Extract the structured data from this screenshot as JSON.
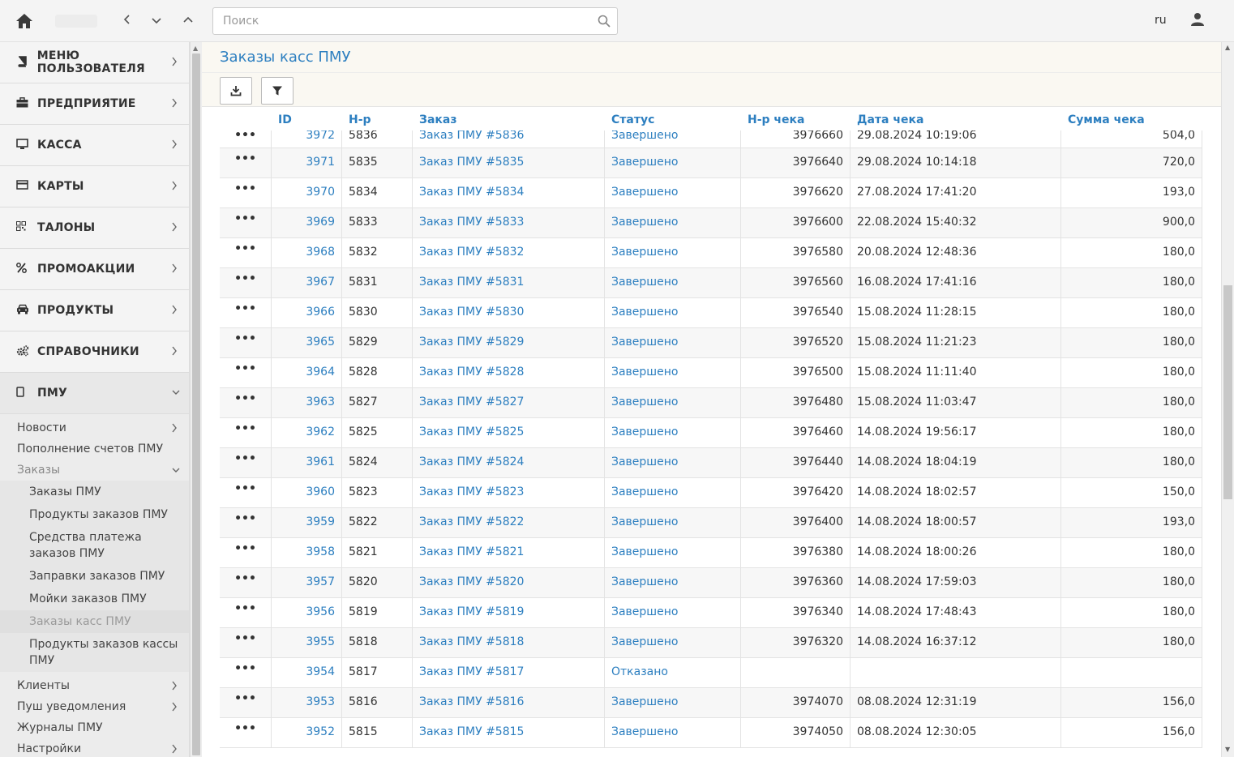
{
  "search": {
    "placeholder": "Поиск"
  },
  "lang": "ru",
  "menu": [
    {
      "label": "МЕНЮ ПОЛЬЗОВАТЕЛЯ",
      "icon": "book-icon"
    },
    {
      "label": "ПРЕДПРИЯТИЕ",
      "icon": "briefcase-icon"
    },
    {
      "label": "КАССА",
      "icon": "monitor-icon"
    },
    {
      "label": "КАРТЫ",
      "icon": "credit-card-icon"
    },
    {
      "label": "ТАЛОНЫ",
      "icon": "qrcode-icon"
    },
    {
      "label": "ПРОМОАКЦИИ",
      "icon": "percent-icon"
    },
    {
      "label": "ПРОДУКТЫ",
      "icon": "car-icon"
    },
    {
      "label": "СПРАВОЧНИКИ",
      "icon": "cogs-icon"
    },
    {
      "label": "ПМУ",
      "icon": "mobile-icon"
    }
  ],
  "pmu_sub": {
    "news": "Новости",
    "topup": "Пополнение счетов ПМУ",
    "orders": "Заказы",
    "orders_sub": [
      "Заказы ПМУ",
      "Продукты заказов ПМУ",
      "Средства платежа заказов ПМУ",
      "Заправки заказов ПМУ",
      "Мойки заказов ПМУ",
      "Заказы касс ПМУ",
      "Продукты заказов кассы ПМУ"
    ],
    "clients": "Клиенты",
    "push": "Пуш уведомления",
    "journals": "Журналы ПМУ",
    "settings": "Настройки"
  },
  "page": {
    "title": "Заказы касс ПМУ"
  },
  "columns": {
    "id": "ID",
    "num": "Н-р",
    "order": "Заказ",
    "status": "Статус",
    "check_num": "Н-р чека",
    "check_date": "Дата чека",
    "check_sum": "Сумма чека"
  },
  "action_label": "•••",
  "rows": [
    {
      "id": "3972",
      "num": "5836",
      "order": "Заказ ПМУ #5836",
      "status": "Завершено",
      "check": "3976660",
      "date": "29.08.2024 10:19:06",
      "sum": "504,0"
    },
    {
      "id": "3971",
      "num": "5835",
      "order": "Заказ ПМУ #5835",
      "status": "Завершено",
      "check": "3976640",
      "date": "29.08.2024 10:14:18",
      "sum": "720,0"
    },
    {
      "id": "3970",
      "num": "5834",
      "order": "Заказ ПМУ #5834",
      "status": "Завершено",
      "check": "3976620",
      "date": "27.08.2024 17:41:20",
      "sum": "193,0"
    },
    {
      "id": "3969",
      "num": "5833",
      "order": "Заказ ПМУ #5833",
      "status": "Завершено",
      "check": "3976600",
      "date": "22.08.2024 15:40:32",
      "sum": "900,0"
    },
    {
      "id": "3968",
      "num": "5832",
      "order": "Заказ ПМУ #5832",
      "status": "Завершено",
      "check": "3976580",
      "date": "20.08.2024 12:48:36",
      "sum": "180,0"
    },
    {
      "id": "3967",
      "num": "5831",
      "order": "Заказ ПМУ #5831",
      "status": "Завершено",
      "check": "3976560",
      "date": "16.08.2024 17:41:16",
      "sum": "180,0"
    },
    {
      "id": "3966",
      "num": "5830",
      "order": "Заказ ПМУ #5830",
      "status": "Завершено",
      "check": "3976540",
      "date": "15.08.2024 11:28:15",
      "sum": "180,0"
    },
    {
      "id": "3965",
      "num": "5829",
      "order": "Заказ ПМУ #5829",
      "status": "Завершено",
      "check": "3976520",
      "date": "15.08.2024 11:21:23",
      "sum": "180,0"
    },
    {
      "id": "3964",
      "num": "5828",
      "order": "Заказ ПМУ #5828",
      "status": "Завершено",
      "check": "3976500",
      "date": "15.08.2024 11:11:40",
      "sum": "180,0"
    },
    {
      "id": "3963",
      "num": "5827",
      "order": "Заказ ПМУ #5827",
      "status": "Завершено",
      "check": "3976480",
      "date": "15.08.2024 11:03:47",
      "sum": "180,0"
    },
    {
      "id": "3962",
      "num": "5825",
      "order": "Заказ ПМУ #5825",
      "status": "Завершено",
      "check": "3976460",
      "date": "14.08.2024 19:56:17",
      "sum": "180,0"
    },
    {
      "id": "3961",
      "num": "5824",
      "order": "Заказ ПМУ #5824",
      "status": "Завершено",
      "check": "3976440",
      "date": "14.08.2024 18:04:19",
      "sum": "180,0"
    },
    {
      "id": "3960",
      "num": "5823",
      "order": "Заказ ПМУ #5823",
      "status": "Завершено",
      "check": "3976420",
      "date": "14.08.2024 18:02:57",
      "sum": "150,0"
    },
    {
      "id": "3959",
      "num": "5822",
      "order": "Заказ ПМУ #5822",
      "status": "Завершено",
      "check": "3976400",
      "date": "14.08.2024 18:00:57",
      "sum": "193,0"
    },
    {
      "id": "3958",
      "num": "5821",
      "order": "Заказ ПМУ #5821",
      "status": "Завершено",
      "check": "3976380",
      "date": "14.08.2024 18:00:26",
      "sum": "180,0"
    },
    {
      "id": "3957",
      "num": "5820",
      "order": "Заказ ПМУ #5820",
      "status": "Завершено",
      "check": "3976360",
      "date": "14.08.2024 17:59:03",
      "sum": "180,0"
    },
    {
      "id": "3956",
      "num": "5819",
      "order": "Заказ ПМУ #5819",
      "status": "Завершено",
      "check": "3976340",
      "date": "14.08.2024 17:48:43",
      "sum": "180,0"
    },
    {
      "id": "3955",
      "num": "5818",
      "order": "Заказ ПМУ #5818",
      "status": "Завершено",
      "check": "3976320",
      "date": "14.08.2024 16:37:12",
      "sum": "180,0"
    },
    {
      "id": "3954",
      "num": "5817",
      "order": "Заказ ПМУ #5817",
      "status": "Отказано",
      "check": "",
      "date": "",
      "sum": ""
    },
    {
      "id": "3953",
      "num": "5816",
      "order": "Заказ ПМУ #5816",
      "status": "Завершено",
      "check": "3974070",
      "date": "08.08.2024 12:31:19",
      "sum": "156,0"
    },
    {
      "id": "3952",
      "num": "5815",
      "order": "Заказ ПМУ #5815",
      "status": "Завершено",
      "check": "3974050",
      "date": "08.08.2024 12:30:05",
      "sum": "156,0"
    }
  ]
}
